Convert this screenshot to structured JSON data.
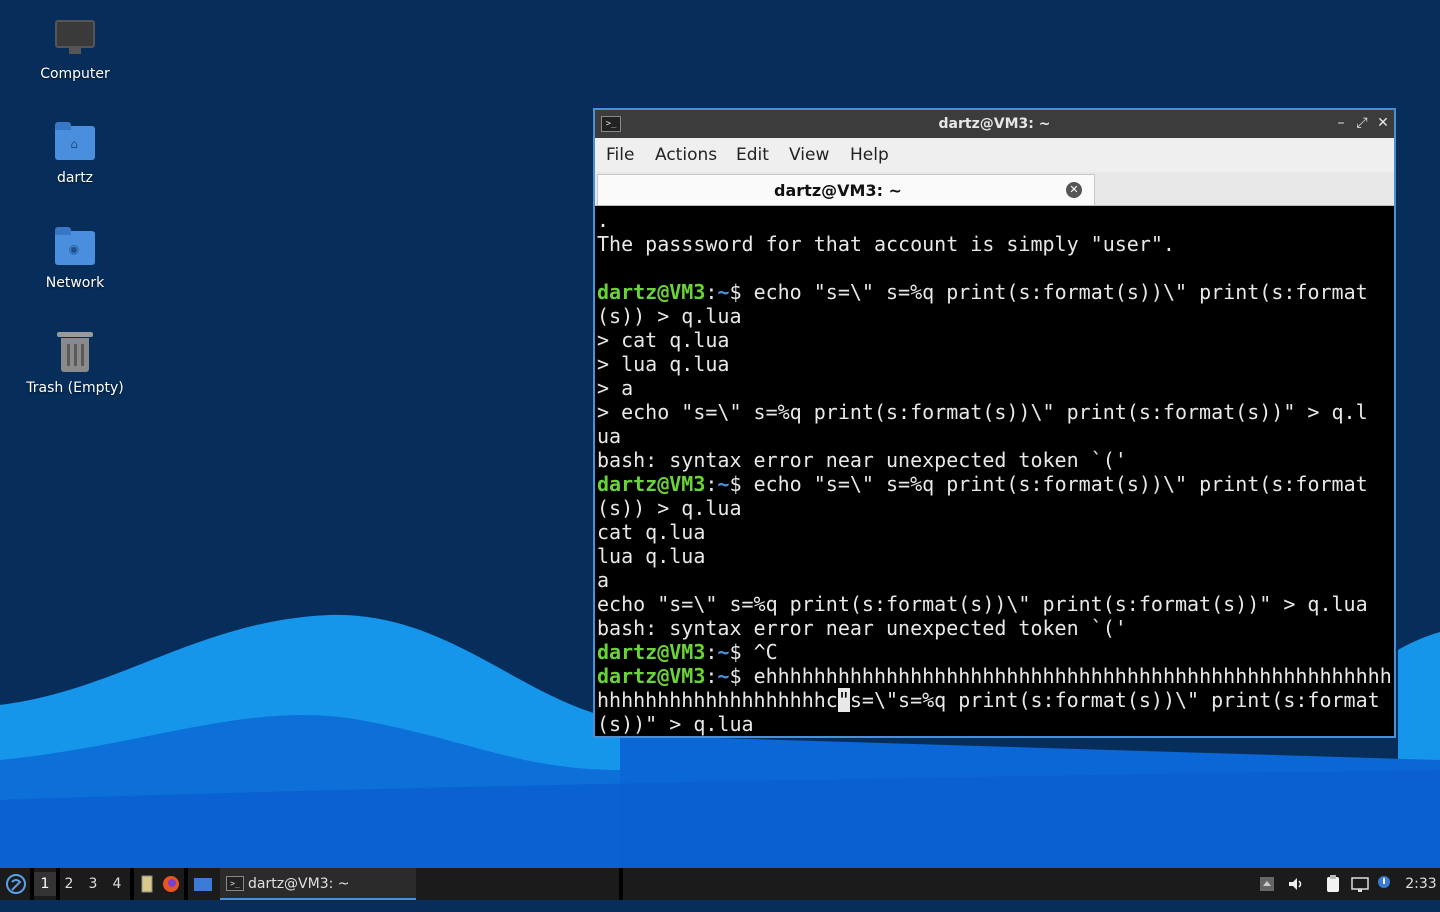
{
  "desktop": {
    "icons": [
      {
        "label": "Computer",
        "icon": "computer-icon"
      },
      {
        "label": "dartz",
        "icon": "home-folder-icon"
      },
      {
        "label": "Network",
        "icon": "network-folder-icon"
      },
      {
        "label": "Trash (Empty)",
        "icon": "trash-icon"
      }
    ]
  },
  "window": {
    "title": "dartz@VM3: ~",
    "controls": {
      "minimize": "–",
      "maximize": "⤢",
      "close": "✕"
    },
    "menu": [
      "File",
      "Actions",
      "Edit",
      "View",
      "Help"
    ],
    "tab": {
      "label": "dartz@VM3: ~",
      "close": "✕"
    }
  },
  "terminal": {
    "prompt": {
      "user": "dartz@VM3",
      "colon": ":",
      "path": "~",
      "symbol": "$"
    },
    "lines": [
      ".",
      "The passsword for that account is simply \"user\".",
      "",
      "echo \"s=\\\" s=%q print(s:format(s))\\\" print(s:format",
      "(s)) > q.lua",
      "> cat q.lua",
      "> lua q.lua",
      "> a",
      "> echo \"s=\\\" s=%q print(s:format(s))\\\" print(s:format(s))\" > q.l",
      "ua",
      "bash: syntax error near unexpected token `('",
      "echo \"s=\\\" s=%q print(s:format(s))\\\" print(s:format",
      "(s)) > q.lua",
      "cat q.lua",
      "lua q.lua",
      "a",
      "echo \"s=\\\" s=%q print(s:format(s))\\\" print(s:format(s))\" > q.lua",
      "bash: syntax error near unexpected token `('",
      "^C",
      "ehhhhhhhhhhhhhhhhhhhhhhhhhhhhhhhhhhhhhhhhhhhhhhhhhhhhh",
      "hhhhhhhhhhhhhhhhhhhc",
      "\"",
      "s=\\\"s=%q print(s:format(s))\\\" print(s:format",
      "(s))\" > q.lua"
    ]
  },
  "taskbar": {
    "workspaces": [
      "1",
      "2",
      "3",
      "4"
    ],
    "task_label": "dartz@VM3: ~",
    "clock": "2:33",
    "launchers": [
      "file-manager-icon",
      "firefox-icon",
      "show-desktop-icon"
    ],
    "tray": [
      "updates-icon",
      "volume-icon",
      "clipboard-icon",
      "network-icon",
      "notification-icon"
    ]
  },
  "colors": {
    "desktop_bg": "#072e5a",
    "wave_light": "#1aa3f0",
    "wave_dark": "#0a5fd0",
    "prompt_user": "#6ad33a",
    "prompt_path": "#4e93de",
    "window_border": "#4a90d9"
  }
}
